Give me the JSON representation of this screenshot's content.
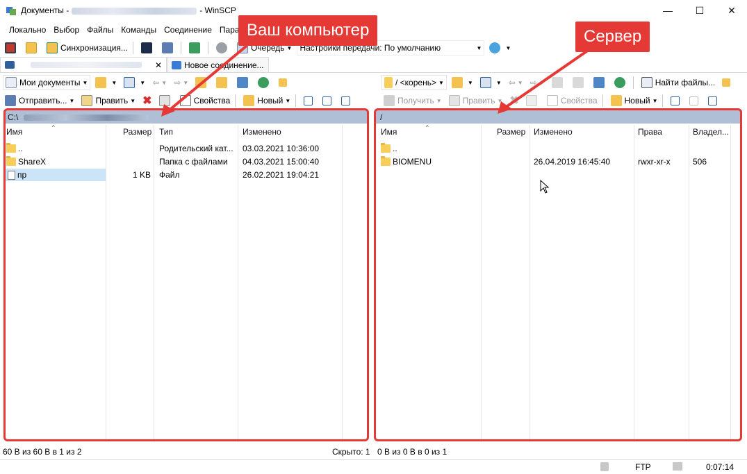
{
  "window": {
    "title_prefix": "Документы -",
    "title_suffix": "- WinSCP",
    "minimize": "—",
    "maximize": "☐",
    "close": "✕"
  },
  "menu": [
    "Локально",
    "Выбор",
    "Файлы",
    "Команды",
    "Соединение",
    "Парам"
  ],
  "toolbar1": {
    "sync": "Синхронизация...",
    "queue": "Очередь",
    "transfer_settings": "Настройки передачи: По умолчанию"
  },
  "tabs": {
    "new_session": "Новое соединение..."
  },
  "left": {
    "location": "Мои документы",
    "send": "Отправить...",
    "edit": "Править",
    "properties": "Свойства",
    "new": "Новый",
    "path": "C:\\",
    "headers": {
      "name": "Имя",
      "size": "Размер",
      "type": "Тип",
      "changed": "Изменено"
    },
    "rows": [
      {
        "name": "..",
        "size": "",
        "type": "Родительский кат...",
        "changed": "03.03.2021  10:36:00"
      },
      {
        "name": "ShareX",
        "size": "",
        "type": "Папка с файлами",
        "changed": "04.03.2021  15:00:40"
      },
      {
        "name": "пр",
        "size": "1 KB",
        "type": "Файл",
        "changed": "26.02.2021  19:04:21"
      }
    ]
  },
  "right": {
    "location": "/ <корень>",
    "download": "Получить",
    "edit": "Править",
    "properties": "Свойства",
    "new": "Новый",
    "find": "Найти файлы...",
    "path": "/",
    "headers": {
      "name": "Имя",
      "size": "Размер",
      "changed": "Изменено",
      "rights": "Права",
      "owner": "Владел..."
    },
    "rows": [
      {
        "name": "..",
        "changed": "",
        "rights": "",
        "owner": ""
      },
      {
        "name": "BIOMENU",
        "changed": "26.04.2019 16:45:40",
        "rights": "rwxr-xr-x",
        "owner": "506"
      }
    ]
  },
  "annotations": {
    "local": "Ваш компьютер",
    "server": "Сервер"
  },
  "status": {
    "left": "60 B из 60 B в 1 из 2",
    "hidden": "Скрыто: 1",
    "right": "0 B из 0 B в 0 из 1",
    "protocol": "FTP",
    "time": "0:07:14"
  }
}
